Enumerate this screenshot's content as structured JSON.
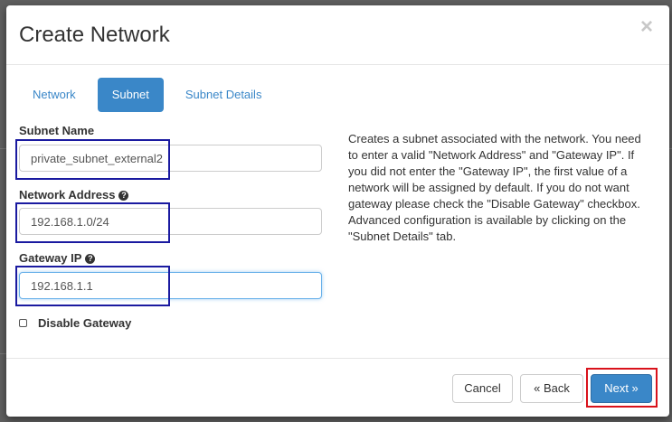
{
  "dialog": {
    "title": "Create Network",
    "close_glyph": "×"
  },
  "tabs": [
    {
      "label": "Network",
      "active": false
    },
    {
      "label": "Subnet",
      "active": true
    },
    {
      "label": "Subnet Details",
      "active": false
    }
  ],
  "form": {
    "subnet_name": {
      "label": "Subnet Name",
      "value": "private_subnet_external2"
    },
    "network_address": {
      "label": "Network Address",
      "value": "192.168.1.0/24",
      "help_icon": "?"
    },
    "gateway_ip": {
      "label": "Gateway IP",
      "value": "192.168.1.1",
      "help_icon": "?"
    },
    "disable_gateway": {
      "label": "Disable Gateway",
      "checked": false
    }
  },
  "help_text": "Creates a subnet associated with the network. You need to enter a valid \"Network Address\" and \"Gateway IP\". If you did not enter the \"Gateway IP\", the first value of a network will be assigned by default. If you do not want gateway please check the \"Disable Gateway\" checkbox. Advanced configuration is available by clicking on the \"Subnet Details\" tab.",
  "footer": {
    "cancel_label": "Cancel",
    "back_label": "«  Back",
    "next_label": "Next  »"
  },
  "colors": {
    "primary": "#3a87c8",
    "highlight_box": "#1a1aa0",
    "next_highlight": "#d9121b"
  }
}
